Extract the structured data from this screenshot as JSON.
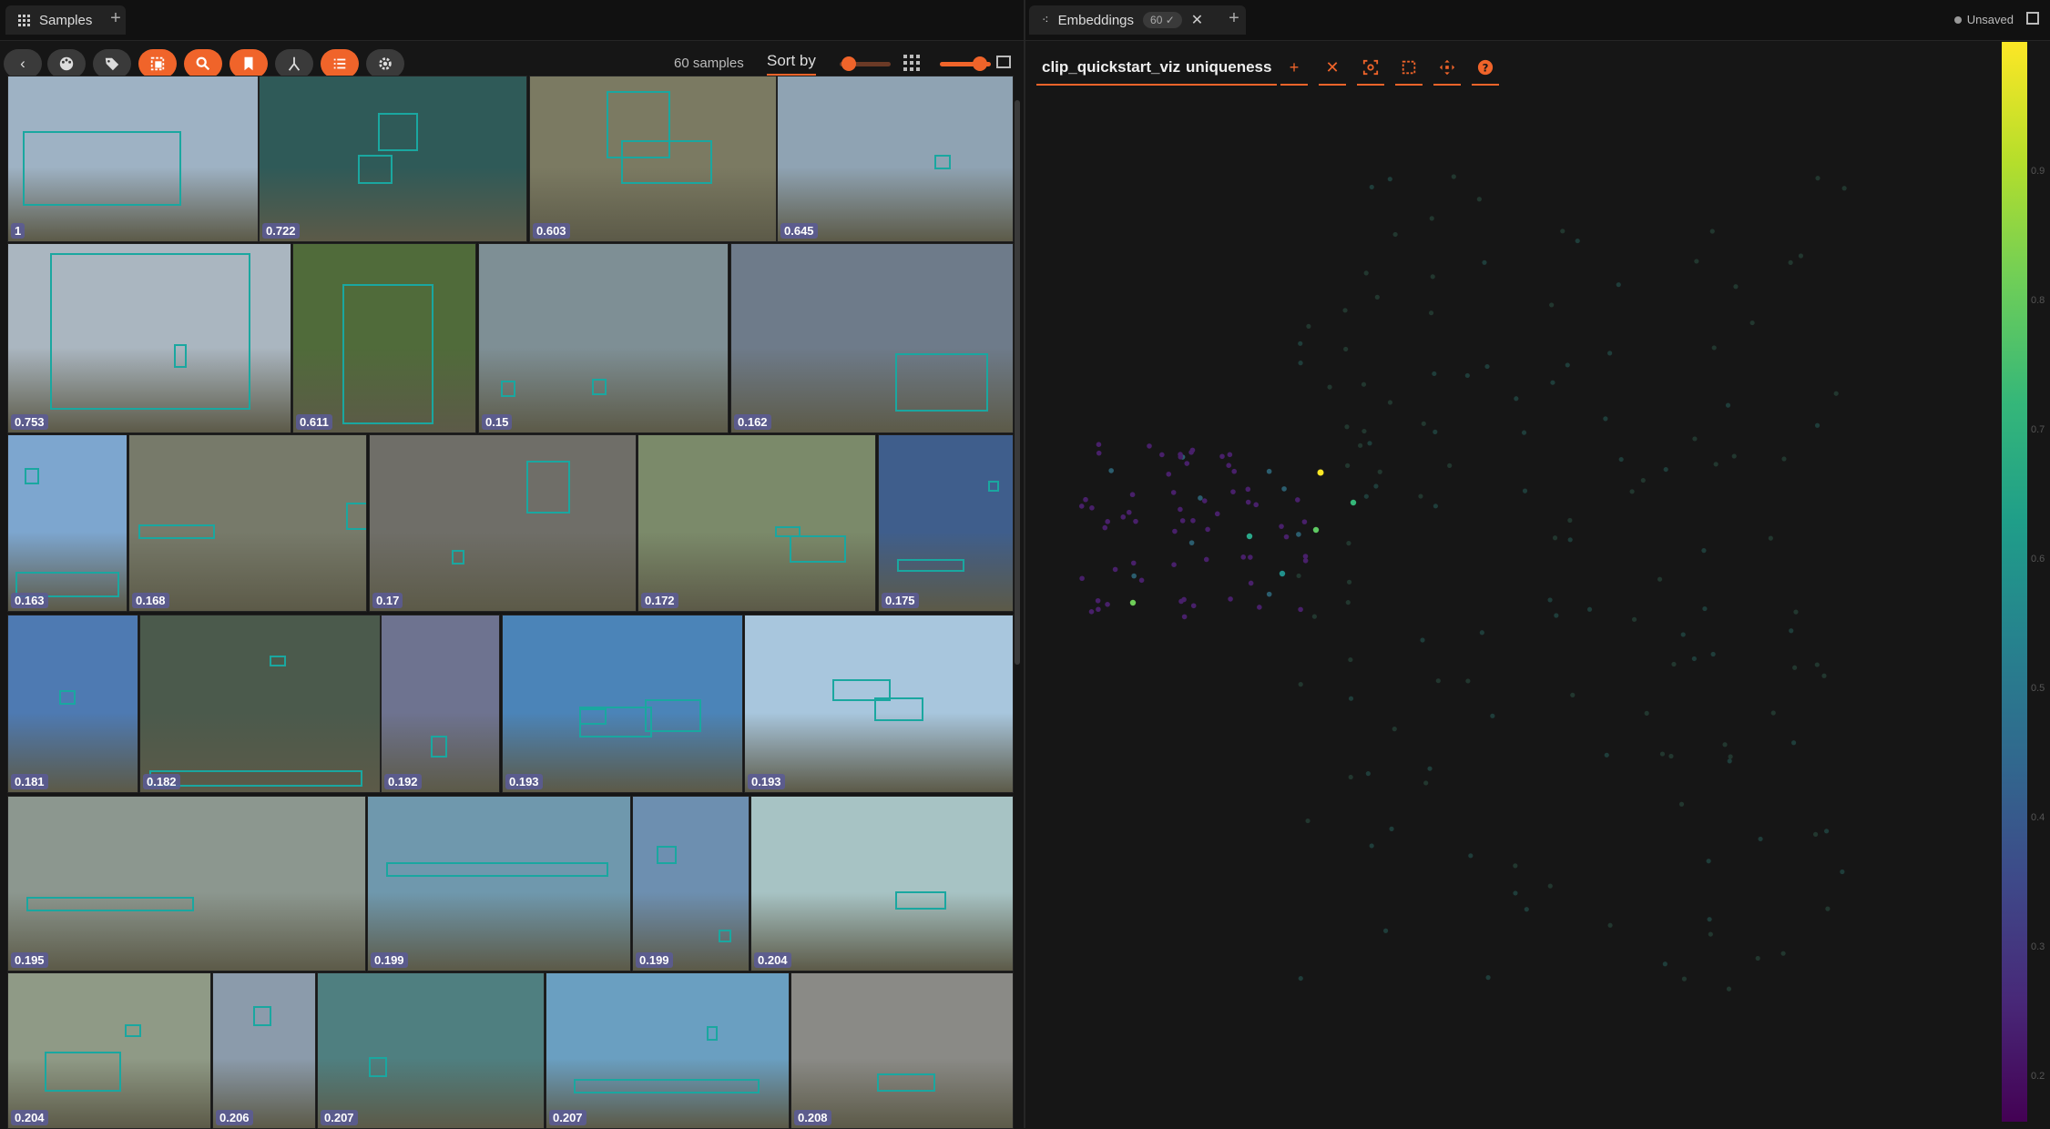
{
  "tabs": {
    "samples_label": "Samples",
    "embeddings_label": "Embeddings",
    "embeddings_badge": "60"
  },
  "toolbar": {
    "sample_count": "60 samples",
    "sort_label": "Sort by"
  },
  "embeddings": {
    "brain_key": "clip_quickstart_viz",
    "color_by": "uniqueness",
    "status": "Unsaved"
  },
  "colorbar": {
    "ticks": [
      "0.9",
      "0.8",
      "0.7",
      "0.6",
      "0.5",
      "0.4",
      "0.3",
      "0.2"
    ]
  },
  "thumbnails": [
    {
      "score": "1",
      "bg": "#9eb2c4"
    },
    {
      "score": "0.722",
      "bg": "#2f5a58"
    },
    {
      "score": "0.603",
      "bg": "#7b7a62"
    },
    {
      "score": "0.645",
      "bg": "#8fa3b3"
    },
    {
      "score": "0.753",
      "bg": "#aab6c0"
    },
    {
      "score": "0.611",
      "bg": "#506b3a"
    },
    {
      "score": "0.15",
      "bg": "#7e8f95"
    },
    {
      "score": "0.162",
      "bg": "#6e7b8a"
    },
    {
      "score": "0.163",
      "bg": "#7da6cf"
    },
    {
      "score": "0.168",
      "bg": "#777a6a"
    },
    {
      "score": "0.17",
      "bg": "#6f6e68"
    },
    {
      "score": "0.172",
      "bg": "#7b8a6a"
    },
    {
      "score": "0.175",
      "bg": "#3f5e8c"
    },
    {
      "score": "0.181",
      "bg": "#4e7ab2"
    },
    {
      "score": "0.182",
      "bg": "#4b5a4c"
    },
    {
      "score": "0.192",
      "bg": "#6e7390"
    },
    {
      "score": "0.193",
      "bg": "#4b84b8"
    },
    {
      "score": "0.193",
      "bg": "#a8c6dd"
    },
    {
      "score": "0.195",
      "bg": "#8c978f"
    },
    {
      "score": "0.199",
      "bg": "#6f98ad"
    },
    {
      "score": "0.199",
      "bg": "#6d8fb0"
    },
    {
      "score": "0.204",
      "bg": "#a7c3c4"
    },
    {
      "score": "0.204",
      "bg": "#8f9a86"
    },
    {
      "score": "0.206",
      "bg": "#8b9bab"
    },
    {
      "score": "0.207",
      "bg": "#4f7f80"
    },
    {
      "score": "0.207",
      "bg": "#6a9fc1"
    },
    {
      "score": "0.208",
      "bg": "#8a8a86"
    }
  ]
}
